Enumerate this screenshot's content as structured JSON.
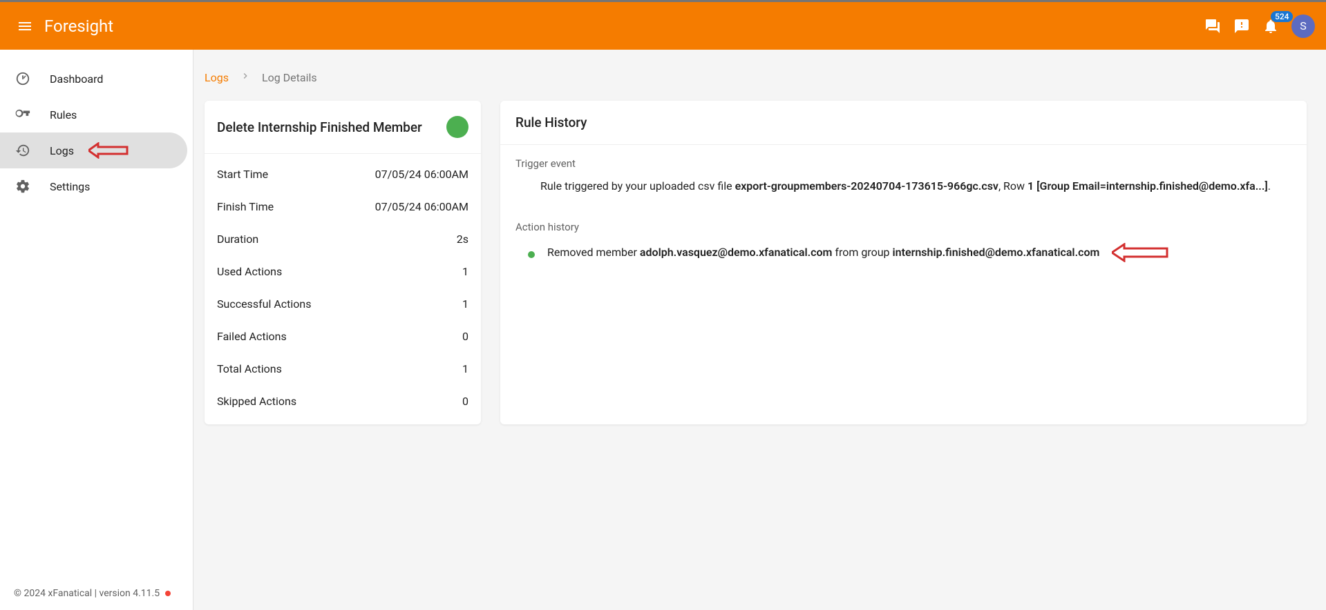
{
  "header": {
    "brand": "Foresight",
    "notification_count": "524",
    "avatar_initial": "S"
  },
  "sidebar": {
    "items": [
      {
        "label": "Dashboard"
      },
      {
        "label": "Rules"
      },
      {
        "label": "Logs"
      },
      {
        "label": "Settings"
      }
    ]
  },
  "footer": {
    "text": "© 2024 xFanatical | version 4.11.5"
  },
  "breadcrumb": {
    "link": "Logs",
    "current": "Log Details"
  },
  "log_card": {
    "title": "Delete Internship Finished Member",
    "stats": [
      {
        "label": "Start Time",
        "value": "07/05/24 06:00AM"
      },
      {
        "label": "Finish Time",
        "value": "07/05/24 06:00AM"
      },
      {
        "label": "Duration",
        "value": "2s"
      },
      {
        "label": "Used Actions",
        "value": "1"
      },
      {
        "label": "Successful Actions",
        "value": "1"
      },
      {
        "label": "Failed Actions",
        "value": "0"
      },
      {
        "label": "Total Actions",
        "value": "1"
      },
      {
        "label": "Skipped Actions",
        "value": "0"
      }
    ]
  },
  "rule_history": {
    "title": "Rule History",
    "trigger_label": "Trigger event",
    "trigger_text_pre": "Rule triggered by your uploaded csv file ",
    "trigger_file": "export-groupmembers-20240704-173615-966gc.csv",
    "trigger_text_mid": ", Row ",
    "trigger_row": "1 [Group Email=internship.finished@demo.xfa...]",
    "trigger_text_post": ".",
    "action_label": "Action history",
    "action_pre": "Removed member ",
    "action_email": "adolph.vasquez@demo.xfanatical.com",
    "action_mid": " from group ",
    "action_group": "internship.finished@demo.xfanatical.com"
  }
}
